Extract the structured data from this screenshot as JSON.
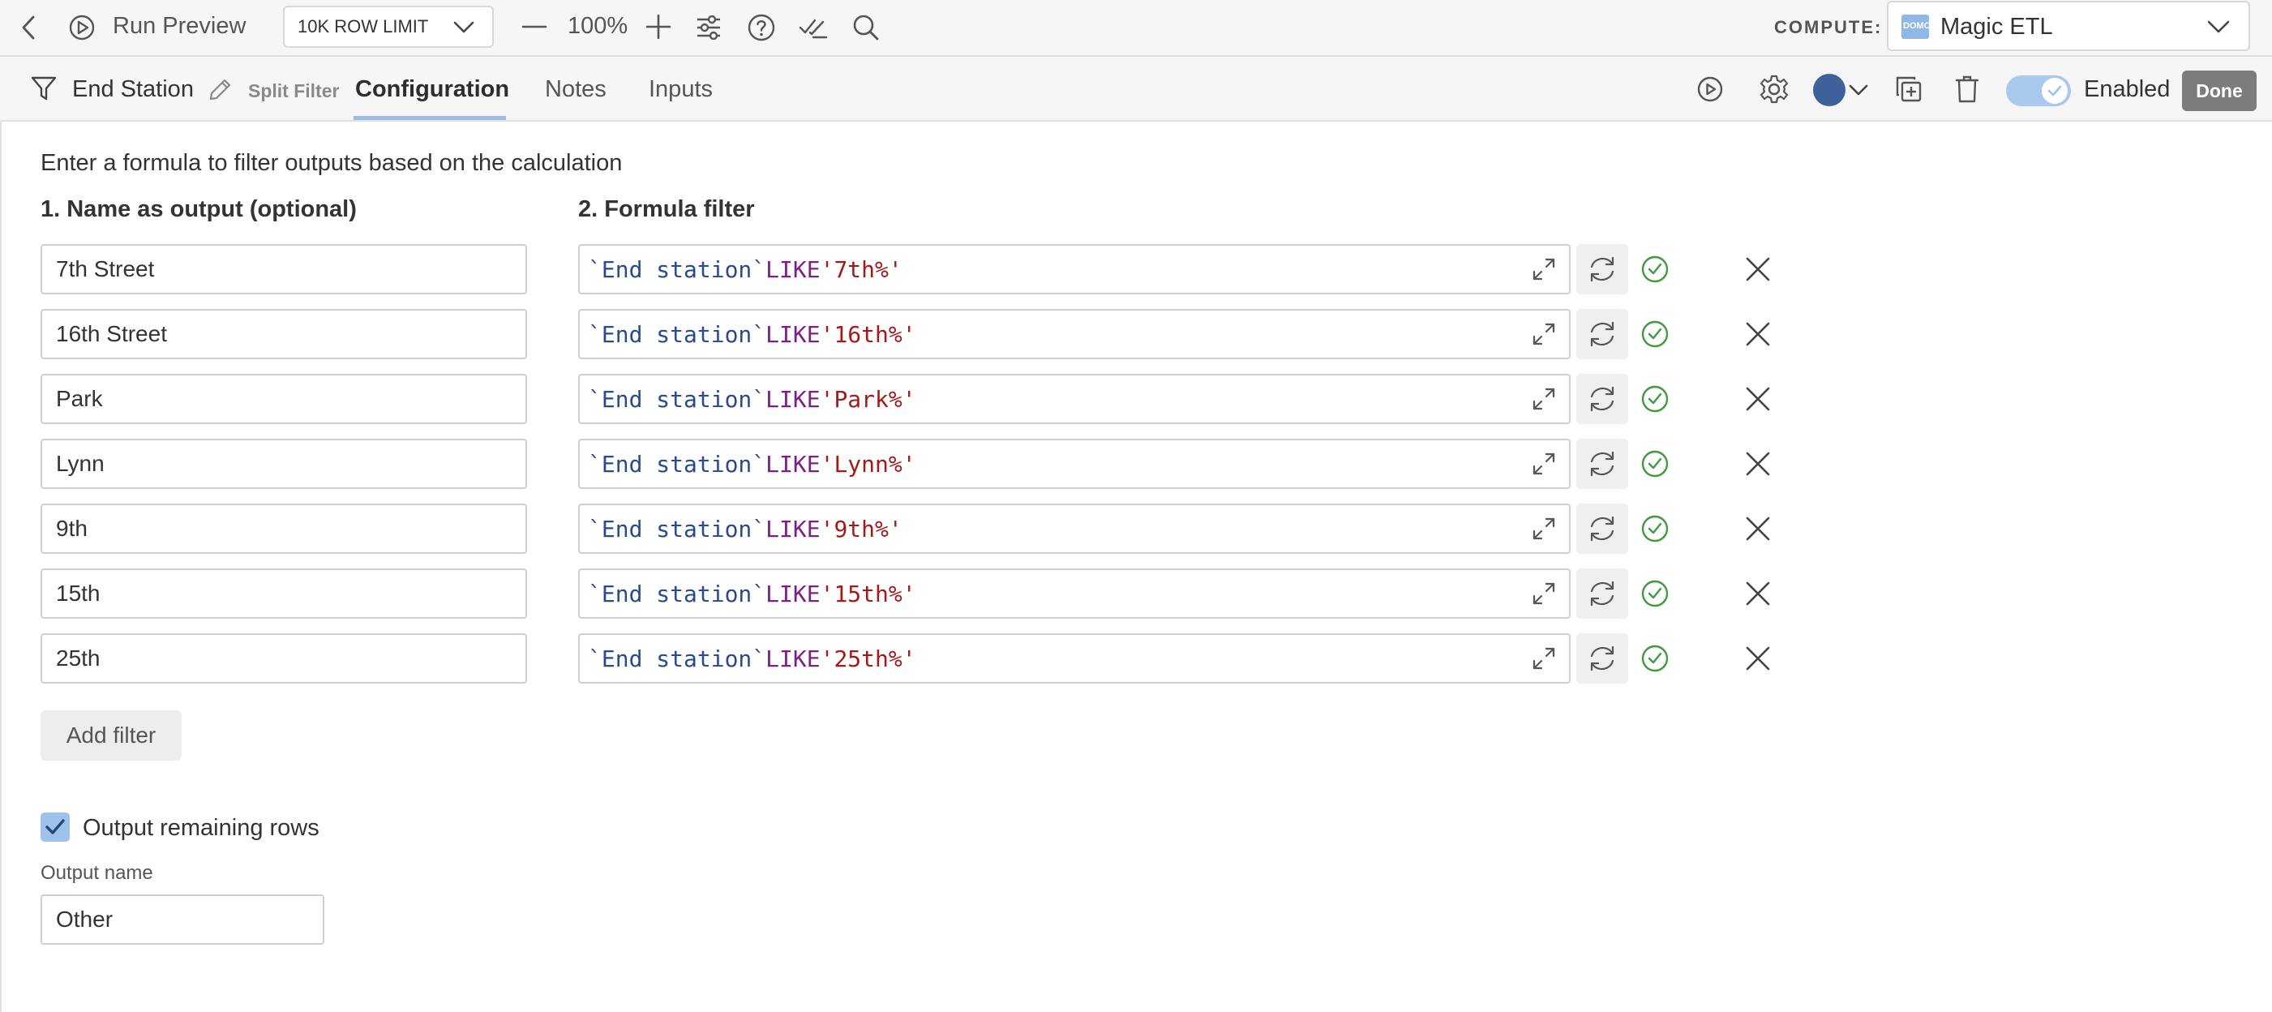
{
  "toolbar": {
    "run_preview_label": "Run Preview",
    "row_limit": "10K ROW LIMIT",
    "zoom_level": "100%",
    "compute_label": "COMPUTE:",
    "compute_engine": "Magic ETL",
    "compute_logo_text": "DOMO"
  },
  "tile": {
    "name": "End Station",
    "type_label": "Split Filter",
    "tabs": [
      "Configuration",
      "Notes",
      "Inputs"
    ],
    "active_tab": "Configuration",
    "enabled_label": "Enabled",
    "enabled": true,
    "done_label": "Done",
    "color_swatch": "#3d6198"
  },
  "config": {
    "description": "Enter a formula to filter outputs based on the calculation",
    "name_header": "1. Name as output (optional)",
    "formula_header": "2. Formula filter",
    "filters": [
      {
        "name": "7th Street",
        "field": "`End station`",
        "op": "LIKE",
        "pattern": "'7th%'"
      },
      {
        "name": "16th Street",
        "field": "`End station`",
        "op": "LIKE",
        "pattern": "'16th%'"
      },
      {
        "name": "Park",
        "field": "`End station`",
        "op": "LIKE",
        "pattern": "'Park%'"
      },
      {
        "name": "Lynn",
        "field": "`End station`",
        "op": "LIKE",
        "pattern": "'Lynn%'"
      },
      {
        "name": "9th",
        "field": "`End station`",
        "op": "LIKE",
        "pattern": "'9th%'"
      },
      {
        "name": "15th",
        "field": "`End station`",
        "op": "LIKE",
        "pattern": "'15th%'"
      },
      {
        "name": "25th",
        "field": "`End station`",
        "op": "LIKE",
        "pattern": "'25th%'"
      }
    ],
    "add_filter_label": "Add filter",
    "output_remaining_label": "Output remaining rows",
    "output_remaining_checked": true,
    "output_name_label": "Output name",
    "output_name_value": "Other"
  },
  "colors": {
    "ident": "#274b8c",
    "keyword": "#7a2282",
    "string": "#a31a1a",
    "valid": "#3e9a3e",
    "accent": "#9ec2ec"
  }
}
